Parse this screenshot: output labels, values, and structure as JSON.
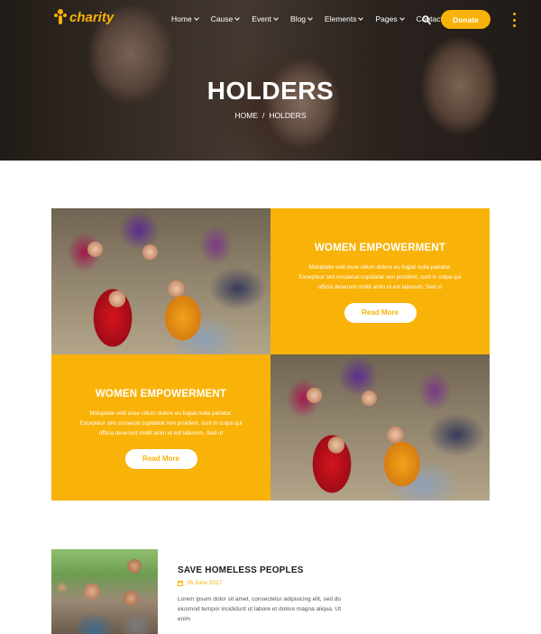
{
  "brand": {
    "name": "charity",
    "color": "#f9b208"
  },
  "nav": {
    "items": [
      {
        "label": "Home",
        "dropdown": true
      },
      {
        "label": "Cause",
        "dropdown": true
      },
      {
        "label": "Event",
        "dropdown": true
      },
      {
        "label": "Blog",
        "dropdown": true
      },
      {
        "label": "Elements",
        "dropdown": true
      },
      {
        "label": "Pages",
        "dropdown": true
      },
      {
        "label": "Contact",
        "dropdown": false
      }
    ],
    "search_icon": "search-icon",
    "donate_label": "Donate",
    "menu_icon": "kebab-menu-icon"
  },
  "hero": {
    "title": "HOLDERS",
    "breadcrumb": {
      "home": "HOME",
      "separator": "/",
      "current": "HOLDERS"
    }
  },
  "features": [
    {
      "title": "WOMEN EMPOWERMENT",
      "text": "Moluptate velit esse cillum dolore eu fugiat nulla pariatur. Excepteur sint occaecat cupidatat non proident, sunt in culpa qui officia deserunt mollit anim id est laborum. Sed ut",
      "button": "Read More"
    },
    {
      "title": "WOMEN EMPOWERMENT",
      "text": "Moluptate velit esse cillum dolore eu fugiat nulla pariatur. Excepteur sint occaecat cupidatat non proident, sunt in culpa qui officia deserunt mollit anim id est laborum. Sed ut",
      "button": "Read More"
    }
  ],
  "blog": {
    "title": "SAVE HOMELESS PEOPLES",
    "date": "26 June 2017",
    "text": "Lorem ipsum dolor sit amet, consectetur adipisicing elit, sed do eiusmod tempor incididunt ut labore et dolore magna aliqua. Ut enim"
  }
}
